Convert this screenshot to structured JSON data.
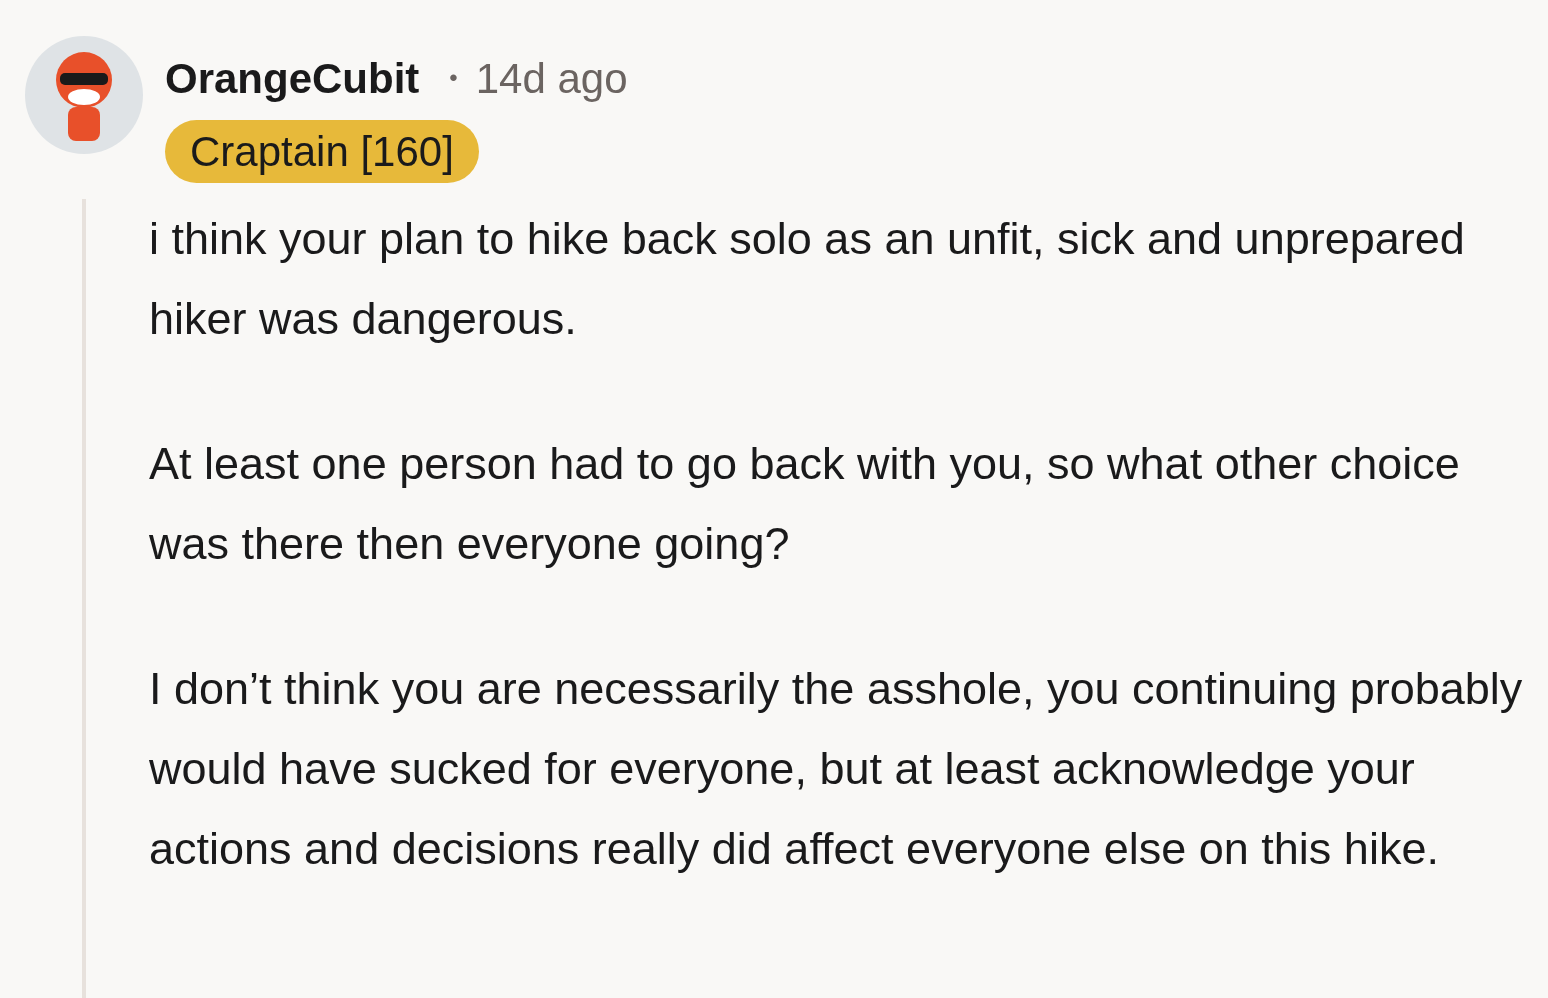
{
  "comment": {
    "author": "OrangeCubit",
    "separator": "•",
    "time": "14d ago",
    "flair": "Craptain [160]",
    "paragraphs": [
      "i think your plan to hike back solo as an unfit, sick and unprepared hiker was dangerous.",
      "At least one person had to go back with you, so what other choice was there then everyone going?",
      "I don’t think you are necessarily the asshole, you continuing probably would have sucked for everyone, but at least acknowledge your actions and decisions really did affect everyone else on this hike."
    ]
  }
}
